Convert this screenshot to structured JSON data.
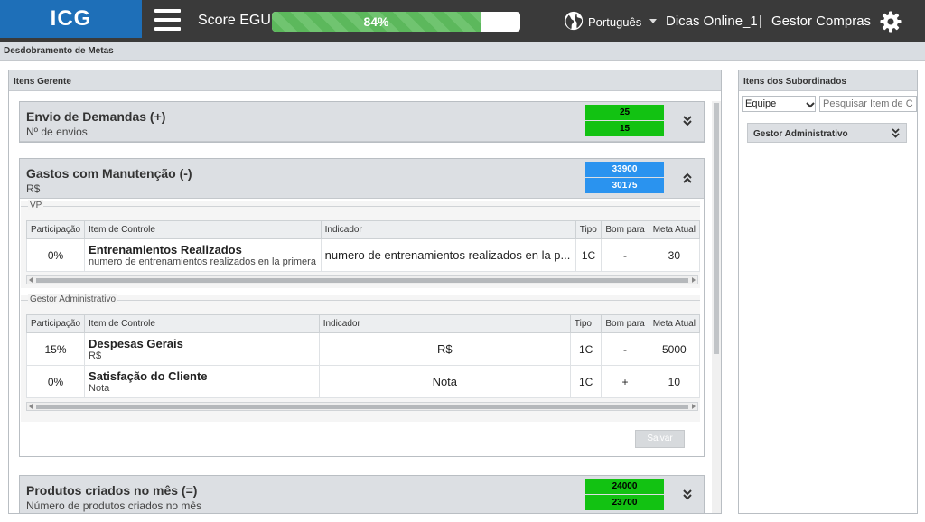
{
  "header": {
    "logo": "ICG",
    "score_label": "Score EGU:",
    "score_percent": "84%",
    "score_value": 84,
    "language": "Português",
    "user": "Dicas Online_1",
    "separator": "|",
    "role": "Gestor Compras"
  },
  "breadcrumb": "Desdobramento de Metas",
  "left_panel": {
    "title": "Itens Gerente",
    "cards": [
      {
        "title": "Envio de Demandas (+)",
        "subtitle": "Nº de envios",
        "badge_top": "25",
        "badge_bottom": "15",
        "badge_color": "#12c212"
      },
      {
        "title": "Gastos com Manutenção (-)",
        "subtitle": "R$",
        "badge_top": "33900",
        "badge_bottom": "30175",
        "badge_color": "#2a93ef"
      },
      {
        "title": "Produtos criados no mês (=)",
        "subtitle": "Número de produtos criados no mês",
        "badge_top": "24000",
        "badge_bottom": "23700",
        "badge_color": "#12c212"
      }
    ],
    "columns": [
      "Participação",
      "Item de Controle",
      "Indicador",
      "Tipo",
      "Bom para",
      "Meta Atual"
    ],
    "groups": [
      {
        "legend": "VP",
        "rows": [
          {
            "participacao": "0%",
            "item_title": "Entrenamientos Realizados",
            "item_sub": "numero de entrenamientos realizados en la primera",
            "indicador": "numero de entrenamientos realizados en la p...",
            "tipo": "1C",
            "bom_para": "-",
            "meta": "30"
          }
        ]
      },
      {
        "legend": "Gestor Administrativo",
        "rows": [
          {
            "participacao": "15%",
            "item_title": "Despesas Gerais",
            "item_sub": "R$",
            "indicador": "R$",
            "tipo": "1C",
            "bom_para": "-",
            "meta": "5000"
          },
          {
            "participacao": "0%",
            "item_title": "Satisfação do Cliente",
            "item_sub": "Nota",
            "indicador": "Nota",
            "tipo": "1C",
            "bom_para": "+",
            "meta": "10"
          }
        ]
      }
    ],
    "save_label": "Salvar"
  },
  "right_panel": {
    "title": "Itens dos Subordinados",
    "team_value": "Equipe",
    "search_placeholder": "Pesquisar Item de Controle",
    "sub_item": "Gestor Administrativo"
  }
}
